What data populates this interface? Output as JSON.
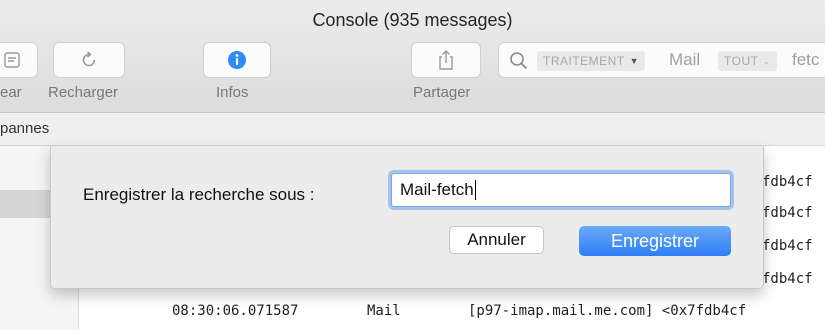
{
  "window": {
    "title": "Console (935 messages)"
  },
  "toolbar": {
    "clear_label": "ear",
    "reload_label": "Recharger",
    "info_label": "Infos",
    "share_label": "Partager"
  },
  "search": {
    "process_chip": "TRAITEMENT",
    "process_value": "Mail",
    "any_chip": "TOUT",
    "any_value": "fetc"
  },
  "pathbar": {
    "text": "pannes"
  },
  "log": {
    "hex_fragment": "fdb4cf",
    "last_row": {
      "time": "08:30:06.071587",
      "process": "Mail",
      "message": "[p97-imap.mail.me.com] <0x7fdb4cf"
    }
  },
  "save_sheet": {
    "label": "Enregistrer la recherche sous :",
    "name_value": "Mail-fetch",
    "cancel_label": "Annuler",
    "save_label": "Enregistrer"
  }
}
